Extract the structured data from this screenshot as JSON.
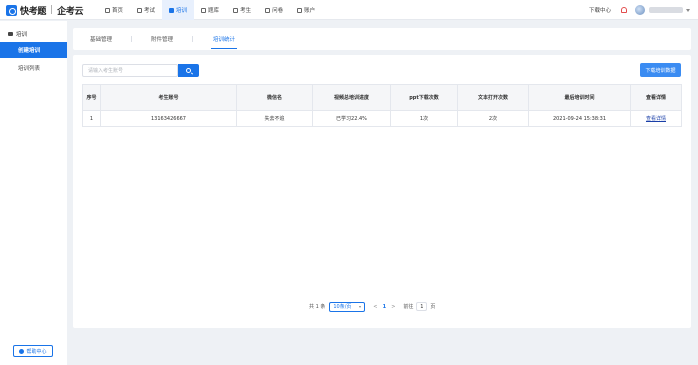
{
  "brand": {
    "name": "快考题",
    "separator": "|",
    "sub": "企考云"
  },
  "nav": [
    {
      "label": "首页",
      "icon": "home-icon",
      "active": false
    },
    {
      "label": "考试",
      "icon": "exam-icon",
      "active": false
    },
    {
      "label": "培训",
      "icon": "training-icon",
      "active": true
    },
    {
      "label": "题库",
      "icon": "question-bank-icon",
      "active": false
    },
    {
      "label": "考生",
      "icon": "examinee-icon",
      "active": false
    },
    {
      "label": "问卷",
      "icon": "survey-icon",
      "active": false
    },
    {
      "label": "账户",
      "icon": "account-icon",
      "active": false
    }
  ],
  "top_right": {
    "download_center": "下载中心"
  },
  "sidebar": {
    "section": "培训",
    "items": [
      {
        "label": "创建培训",
        "active": true
      },
      {
        "label": "培训列表",
        "active": false
      }
    ],
    "help": "帮助中心"
  },
  "tabs": [
    {
      "label": "基础管理",
      "active": false
    },
    {
      "label": "附件管理",
      "active": false
    },
    {
      "label": "培训统计",
      "active": true
    }
  ],
  "search": {
    "placeholder": "请输入考生账号",
    "value": ""
  },
  "download_button": "下载培训数据",
  "table": {
    "headers": [
      "序号",
      "考生账号",
      "微信名",
      "视频总培训进度",
      "ppt下载次数",
      "文本打开次数",
      "最后培训时间",
      "查看详情"
    ],
    "rows": [
      [
        "1",
        "13163426667",
        "失去不追",
        "已学习22.4%",
        "1次",
        "2次",
        "2021-09-24 15:38:31",
        "查看详情"
      ]
    ]
  },
  "pagination": {
    "total": "共 1 条",
    "page_size": "10条/页",
    "prev": "<",
    "current": "1",
    "next": ">",
    "goto_label": "前往",
    "goto_value": "1",
    "page_suffix": "页"
  },
  "colors": {
    "accent": "#1a74e8",
    "link": "#1a3fa8"
  }
}
